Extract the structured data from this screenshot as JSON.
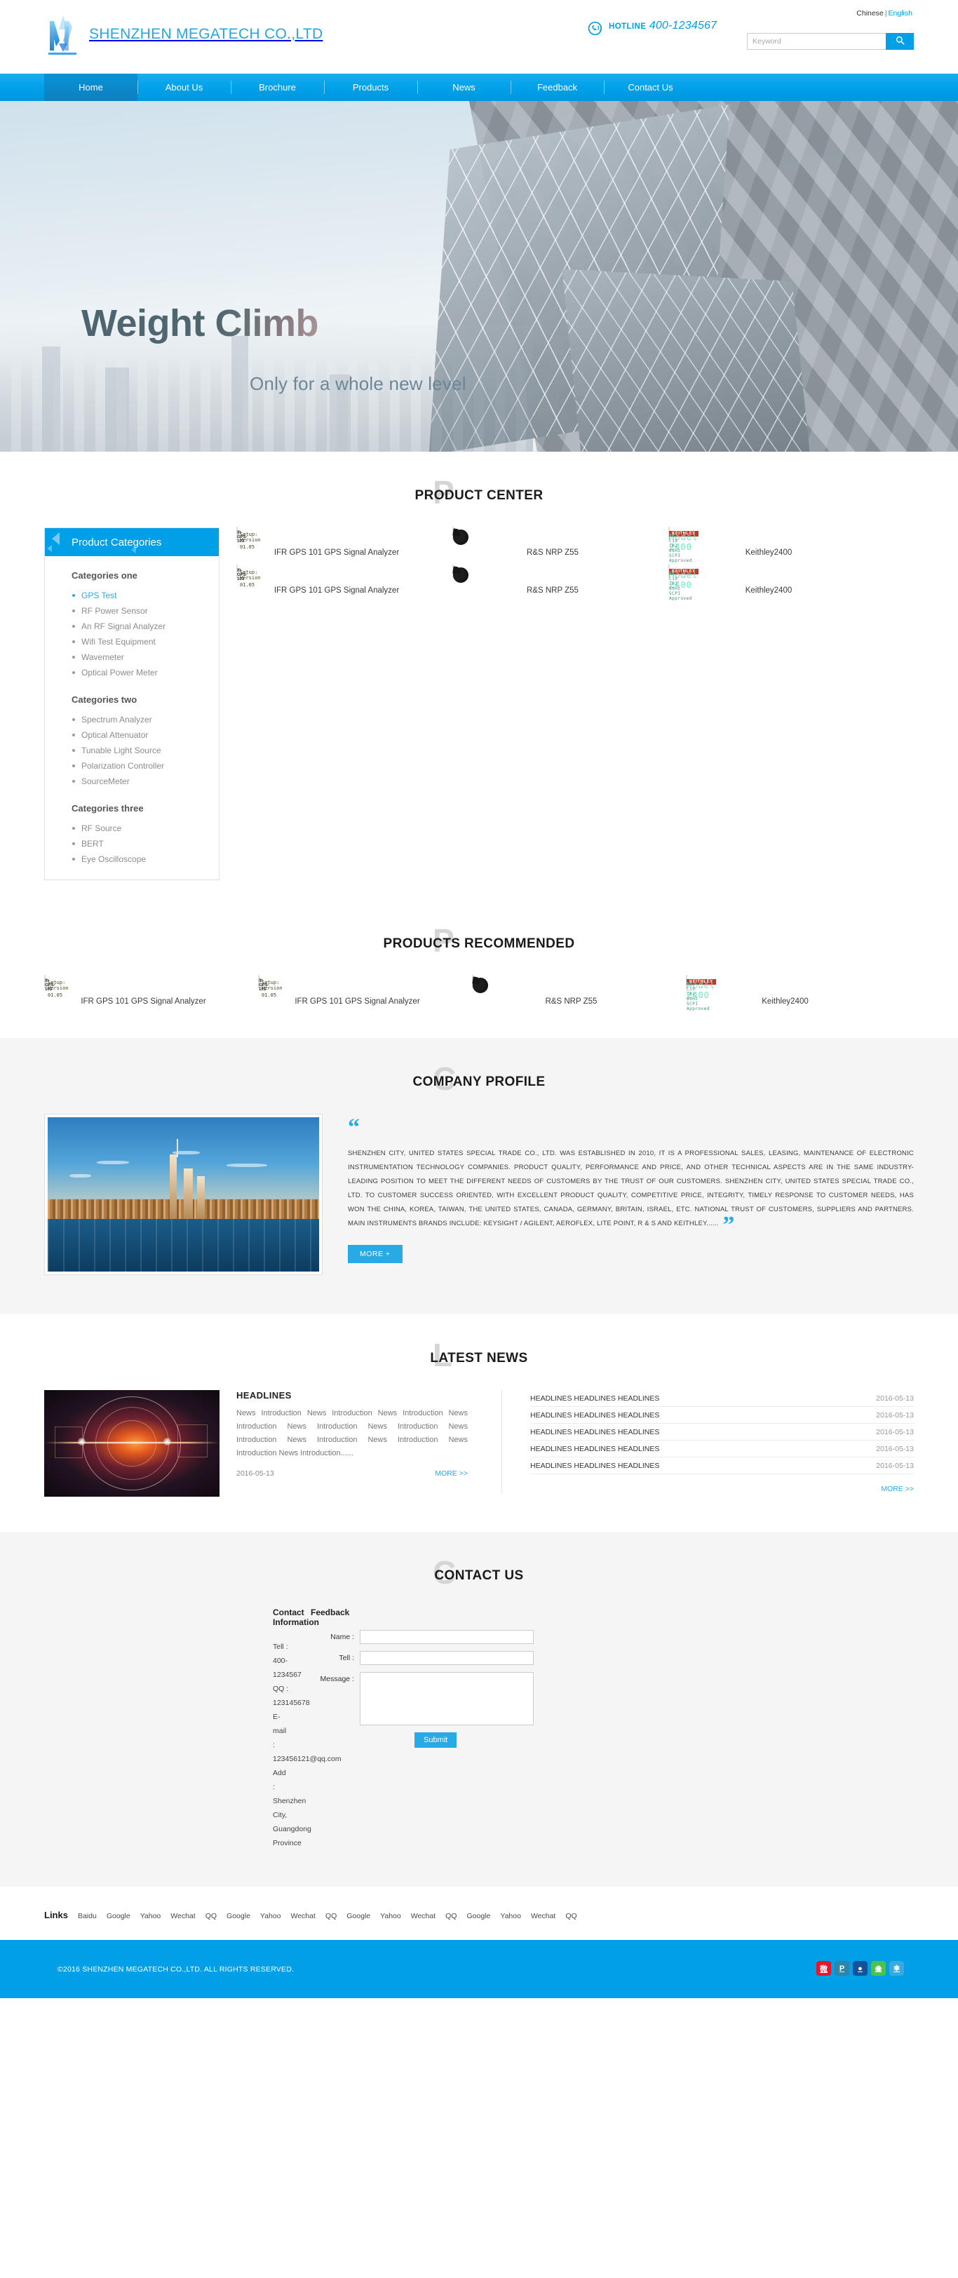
{
  "header": {
    "company": "SHENZHEN MEGATECH CO.,LTD",
    "lang_cn": "Chinese",
    "lang_sep": "|",
    "lang_en": "English",
    "hotline_label": "HOTLINE",
    "hotline_number": "400-1234567",
    "search_placeholder": "Keyword",
    "search_value": ""
  },
  "nav": {
    "items": [
      {
        "label": "Home",
        "active": true
      },
      {
        "label": "About Us",
        "active": false
      },
      {
        "label": "Brochure",
        "active": false
      },
      {
        "label": "Products",
        "active": false
      },
      {
        "label": "News",
        "active": false
      },
      {
        "label": "Feedback",
        "active": false
      },
      {
        "label": "Contact Us",
        "active": false
      }
    ]
  },
  "banner": {
    "title": "Weight Climb",
    "subtitle": "Only for a whole new level"
  },
  "product_center": {
    "ghost": "P",
    "title": "PRODUCT CENTER",
    "sidebar_title": "Product Categories",
    "groups": [
      {
        "title": "Categories one",
        "items": [
          {
            "label": "GPS Test",
            "active": true
          },
          {
            "label": "RF Power Sensor",
            "active": false
          },
          {
            "label": "An RF Signal Analyzer",
            "active": false
          },
          {
            "label": "Wifi Test Equipment",
            "active": false
          },
          {
            "label": "Wavemeter",
            "active": false
          },
          {
            "label": "Optical Power Meter",
            "active": false
          }
        ]
      },
      {
        "title": "Categories two",
        "items": [
          {
            "label": "Spectrum Analyzer",
            "active": false
          },
          {
            "label": "Optical Attenuator",
            "active": false
          },
          {
            "label": "Tunable Light Source",
            "active": false
          },
          {
            "label": "Polarization Controller",
            "active": false
          },
          {
            "label": "SourceMeter",
            "active": false
          }
        ]
      },
      {
        "title": "Categories three",
        "items": [
          {
            "label": "RF Source",
            "active": false
          },
          {
            "label": "BERT",
            "active": false
          },
          {
            "label": "Eye Oscilloscope",
            "active": false
          }
        ]
      }
    ],
    "products": [
      {
        "name": "IFR GPS 101 GPS Signal Analyzer",
        "art": "gps"
      },
      {
        "name": "R&S NRP Z55",
        "art": "cable"
      },
      {
        "name": "Keithley2400",
        "art": "keithley"
      },
      {
        "name": "IFR GPS 101 GPS Signal Analyzer",
        "art": "gps"
      },
      {
        "name": "R&S NRP Z55",
        "art": "cable"
      },
      {
        "name": "Keithley2400",
        "art": "keithley"
      }
    ],
    "gps_lcd_line1": "Setup:  Version",
    "gps_lcd_line2": "01.05",
    "gps_brand": "ifr GPS-101",
    "keithley_model": "Model 2400",
    "keithley_sub": "Rev C19   102 60Hz SCPI Approved",
    "keithley_brand": "KEITHLEY"
  },
  "recommended": {
    "ghost": "P",
    "title": "PRODUCTS RECOMMENDED",
    "products": [
      {
        "name": "IFR GPS 101 GPS Signal Analyzer",
        "art": "gps"
      },
      {
        "name": "IFR GPS 101 GPS Signal Analyzer",
        "art": "gps"
      },
      {
        "name": "R&S NRP Z55",
        "art": "cable"
      },
      {
        "name": "Keithley2400",
        "art": "keithley"
      }
    ]
  },
  "profile": {
    "ghost": "C",
    "title": "COMPANY PROFILE",
    "quote_open": "“",
    "quote_close": "”",
    "paragraph": "SHENZHEN CITY, UNITED STATES SPECIAL TRADE CO., LTD. WAS ESTABLISHED IN 2010, IT IS A PROFESSIONAL SALES, LEASING, MAINTENANCE OF ELECTRONIC INSTRUMENTATION TECHNOLOGY COMPANIES. PRODUCT QUALITY, PERFORMANCE AND PRICE, AND OTHER TECHNICAL ASPECTS ARE IN THE SAME INDUSTRY-LEADING POSITION TO MEET THE DIFFERENT NEEDS OF CUSTOMERS BY THE TRUST OF OUR CUSTOMERS. SHENZHEN CITY, UNITED STATES SPECIAL TRADE CO., LTD. TO CUSTOMER SUCCESS ORIENTED, WITH EXCELLENT PRODUCT QUALITY, COMPETITIVE PRICE, INTEGRITY, TIMELY RESPONSE TO CUSTOMER NEEDS, HAS WON THE CHINA, KOREA, TAIWAN, THE UNITED STATES, CANADA, GERMANY, BRITAIN, ISRAEL, ETC. NATIONAL TRUST OF CUSTOMERS, SUPPLIERS AND PARTNERS. MAIN INSTRUMENTS BRANDS INCLUDE: KEYSIGHT / AGILENT, AEROFLEX, LITE POINT, R & S AND KEITHLEY......",
    "more_label": "MORE +"
  },
  "news": {
    "ghost": "L",
    "title": "LATEST NEWS",
    "featured": {
      "headline": "HEADLINES",
      "summary": "News Introduction News Introduction News Introduction News Introduction News Introduction News Introduction News Introduction News Introduction News Introduction News Introduction News Introduction......",
      "date": "2016-05-13",
      "more_label": "MORE >>"
    },
    "list": [
      {
        "title": "HEADLINES HEADLINES HEADLINES",
        "date": "2016-05-13"
      },
      {
        "title": "HEADLINES HEADLINES HEADLINES",
        "date": "2016-05-13"
      },
      {
        "title": "HEADLINES HEADLINES HEADLINES",
        "date": "2016-05-13"
      },
      {
        "title": "HEADLINES HEADLINES HEADLINES",
        "date": "2016-05-13"
      },
      {
        "title": "HEADLINES HEADLINES HEADLINES",
        "date": "2016-05-13"
      }
    ],
    "list_more_label": "MORE >>"
  },
  "contact": {
    "ghost": "C",
    "title": "CONTACT US",
    "info_title": "Contact Information",
    "tel": "Tell : 400-1234567",
    "qq": "QQ : 123145678",
    "email": "E-mail : 123456121@qq.com",
    "address": "Add : Shenzhen City, Guangdong Province",
    "feedback_title": "Feedback",
    "label_name": "Name :",
    "label_tel": "Tell :",
    "label_message": "Message :",
    "value_name": "",
    "value_tel": "",
    "value_message": "",
    "submit_label": "Submit"
  },
  "links": {
    "label": "Links",
    "items": [
      "Baidu",
      "Google",
      "Yahoo",
      "Wechat",
      "QQ",
      "Google",
      "Yahoo",
      "Wechat",
      "QQ",
      "Google",
      "Yahoo",
      "Wechat",
      "QQ",
      "Google",
      "Yahoo",
      "Wechat",
      "QQ"
    ]
  },
  "footer": {
    "copyright": "©2016 SHENZHEN MEGATECH CO.,LTD. ALL RIGHTS RESERVED.",
    "social": [
      {
        "name": "weibo-icon",
        "glyph": "微",
        "cls": "s-weibo"
      },
      {
        "name": "pinterest-icon",
        "glyph": "P",
        "cls": "s-pin"
      },
      {
        "name": "qq-icon",
        "glyph": "●",
        "cls": "s-qq"
      },
      {
        "name": "wechat-icon",
        "glyph": "◉",
        "cls": "s-wechat"
      },
      {
        "name": "baidu-icon",
        "glyph": "✱",
        "cls": "s-baidu"
      }
    ]
  },
  "colors": {
    "accent": "#00a0e9",
    "accent_light": "#29a9e6",
    "section_bg": "#f5f5f5"
  }
}
